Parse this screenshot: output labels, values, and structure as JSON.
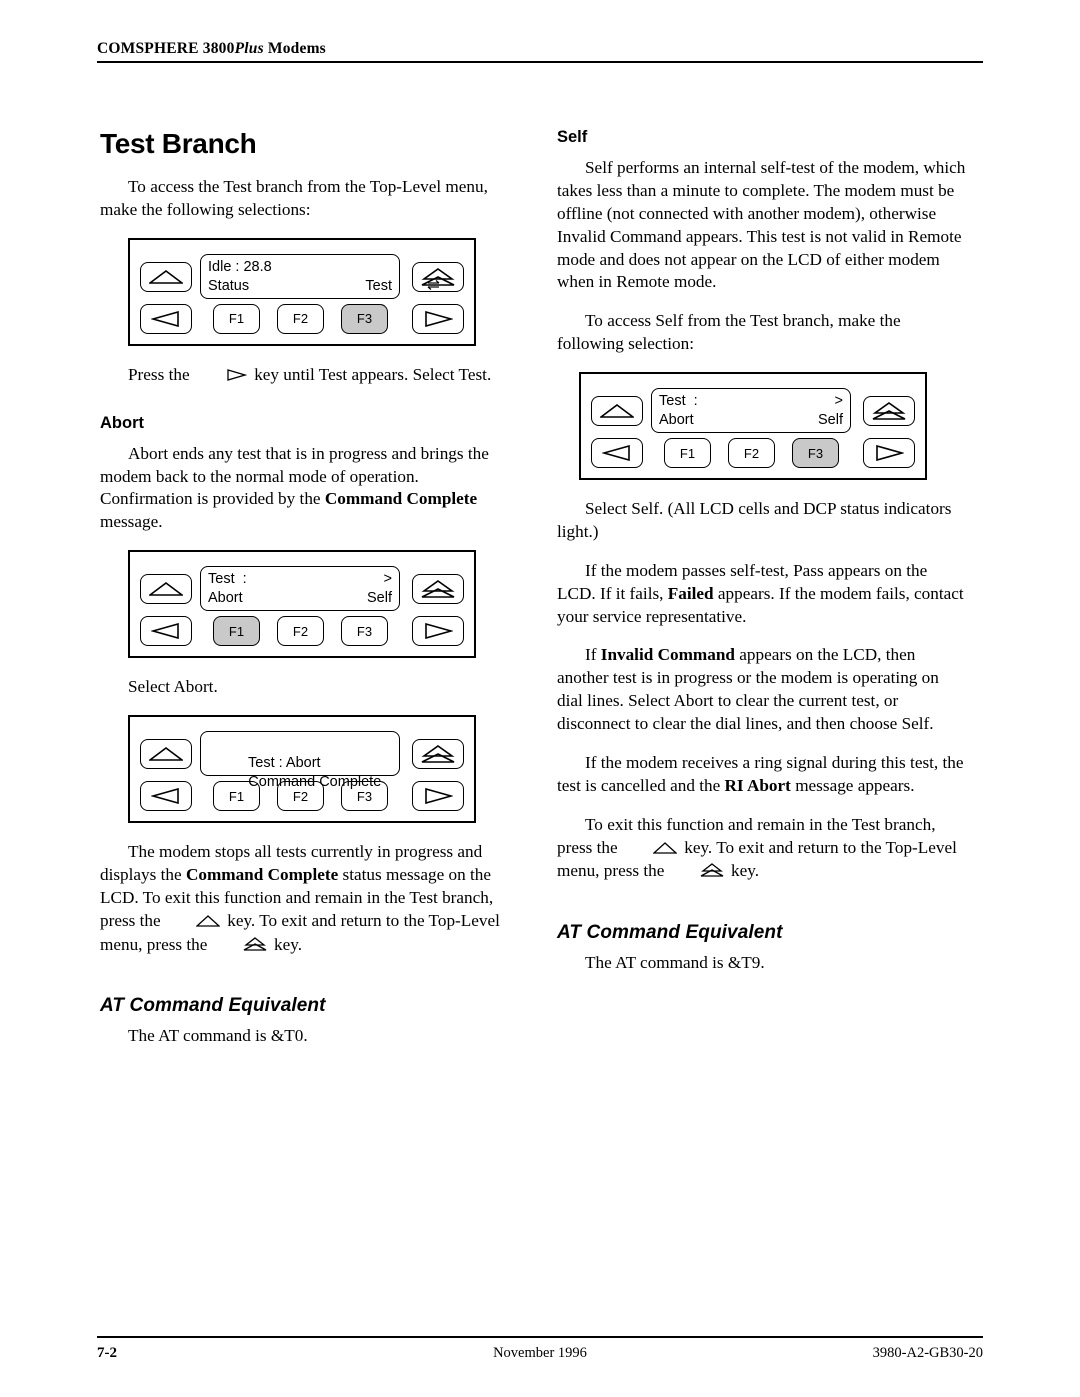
{
  "header": {
    "title_prefix": "COMSPHERE 3800",
    "title_italic": "Plus",
    "title_suffix": " Modems"
  },
  "left_column": {
    "chapter_title": "Test Branch",
    "intro_paragraph": "To access the Test branch from the Top-Level menu, make the following selections:",
    "panel_1": {
      "lcd_line1_left": "Idle : 28.8",
      "lcd_line1_right_icon": "transmit-receive-icon",
      "lcd_line2_left": "Status",
      "lcd_line2_right": "Test",
      "f1": "F1",
      "f2": "F2",
      "f3": "F3",
      "selected_key": "F3"
    },
    "press_key_text_before": "Press the ",
    "press_key_icon": "right-arrow-key-icon",
    "press_key_text_after": " key until Test appears. Select Test.",
    "abort_heading": "Abort",
    "abort_paragraph_1a": "Abort ends any test that is in progress and brings the modem back to the normal mode of operation. Confirmation is provided by the ",
    "abort_paragraph_1b": "Command Complete",
    "abort_paragraph_1c": " message.",
    "panel_2": {
      "lcd_line1_left": "Test  :",
      "lcd_line1_right": ">",
      "lcd_line2_left": "Abort",
      "lcd_line2_right": "Self",
      "f1": "F1",
      "f2": "F2",
      "f3": "F3",
      "selected_key": "F1"
    },
    "select_abort_text": "Select Abort.",
    "panel_3": {
      "lcd_line1_left": "Test : Abort",
      "lcd_line2_left": "Command Complete",
      "f1": "F1",
      "f2": "F2",
      "f3": "F3",
      "selected_key": ""
    },
    "closing_paragraph_a": "The modem stops all tests currently in progress and displays the ",
    "closing_paragraph_b": "Command Complete",
    "closing_paragraph_c": " status message on the LCD. To exit this function and remain in the Test branch, press the ",
    "closing_paragraph_d": " key. To exit and return to the Top-Level menu, press the ",
    "closing_paragraph_e": " key.",
    "at_heading": "AT Command Equivalent",
    "at_text": "The AT command is &T0."
  },
  "right_column": {
    "self_heading": "Self",
    "self_paragraph_1": "Self performs an internal self-test of the modem, which takes less than a minute to complete. The modem must be offline (not connected with another modem), otherwise Invalid Command appears. This test is not valid in Remote mode and does not appear on the LCD of either modem when in Remote mode.",
    "self_paragraph_2": "To access Self from the Test branch, make the following selection:",
    "panel_4": {
      "lcd_line1_left": "Test  :",
      "lcd_line1_right": ">",
      "lcd_line2_left": "Abort",
      "lcd_line2_right": "Self",
      "f1": "F1",
      "f2": "F2",
      "f3": "F3",
      "selected_key": "F3"
    },
    "select_self_text": "Select Self. (All LCD cells and DCP status indicators light.)",
    "pass_fail_a": "If the modem passes self-test, Pass appears on the LCD. If it fails, ",
    "pass_fail_b": "Failed",
    "pass_fail_c": " appears. If the modem fails, contact your service representative.",
    "invalid_a": "If ",
    "invalid_b": "Invalid Command",
    "invalid_c": " appears on the LCD, then another test is in progress or the modem is operating on dial lines. Select Abort to clear the current test, or disconnect to clear the dial lines, and then choose Self.",
    "ring_a": "If the modem receives a ring signal during this test, the test is cancelled and the ",
    "ring_b": "RI Abort",
    "ring_c": " message appears.",
    "exit_a": "To exit this function and remain in the Test branch, press the ",
    "exit_b": " key. To exit and return to the Top-Level menu, press the ",
    "exit_c": " key.",
    "at_heading": "AT Command Equivalent",
    "at_text": "The AT command is &T9."
  },
  "footer": {
    "page_number": "7-2",
    "date": "November 1996",
    "doc_number": "3980-A2-GB30-20"
  },
  "colors": {
    "selected_key_bg": "#c9c9c9",
    "ink": "#000000",
    "page_bg": "#ffffff"
  }
}
